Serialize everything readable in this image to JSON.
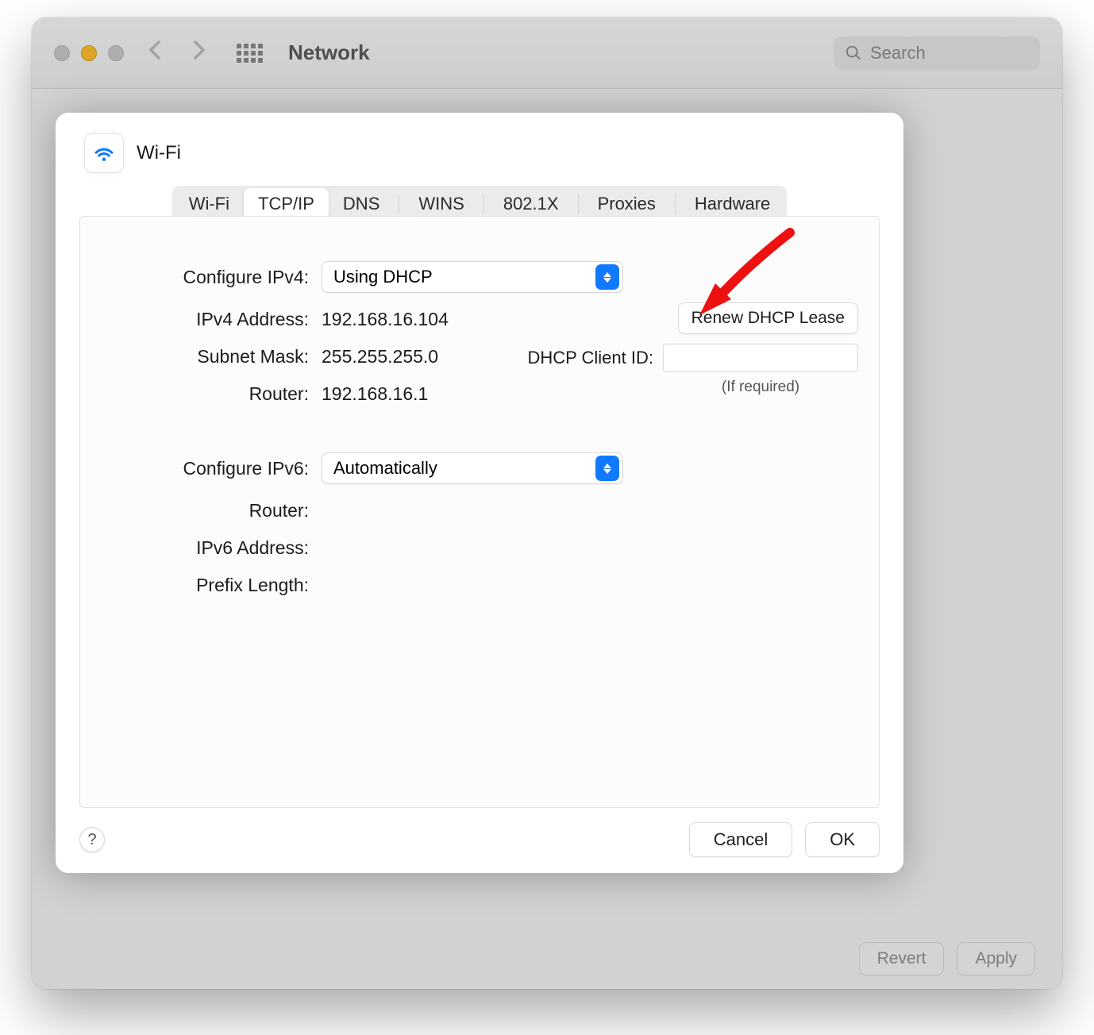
{
  "window": {
    "title": "Network",
    "search_placeholder": "Search",
    "bottom_buttons": {
      "revert": "Revert",
      "apply": "Apply"
    }
  },
  "sheet": {
    "title": "Wi-Fi",
    "tabs": [
      "Wi-Fi",
      "TCP/IP",
      "DNS",
      "WINS",
      "802.1X",
      "Proxies",
      "Hardware"
    ],
    "active_tab_index": 1,
    "labels": {
      "configure_ipv4": "Configure IPv4:",
      "ipv4_address": "IPv4 Address:",
      "subnet_mask": "Subnet Mask:",
      "router4": "Router:",
      "configure_ipv6": "Configure IPv6:",
      "router6": "Router:",
      "ipv6_address": "IPv6 Address:",
      "prefix_length": "Prefix Length:",
      "dhcp_client_id": "DHCP Client ID:"
    },
    "values": {
      "configure_ipv4": "Using DHCP",
      "ipv4_address": "192.168.16.104",
      "subnet_mask": "255.255.255.0",
      "router4": "192.168.16.1",
      "configure_ipv6": "Automatically",
      "router6": "",
      "ipv6_address": "",
      "prefix_length": "",
      "dhcp_client_id": ""
    },
    "buttons": {
      "renew_dhcp": "Renew DHCP Lease",
      "cancel": "Cancel",
      "ok": "OK"
    },
    "hint": "(If required)",
    "help": "?"
  }
}
